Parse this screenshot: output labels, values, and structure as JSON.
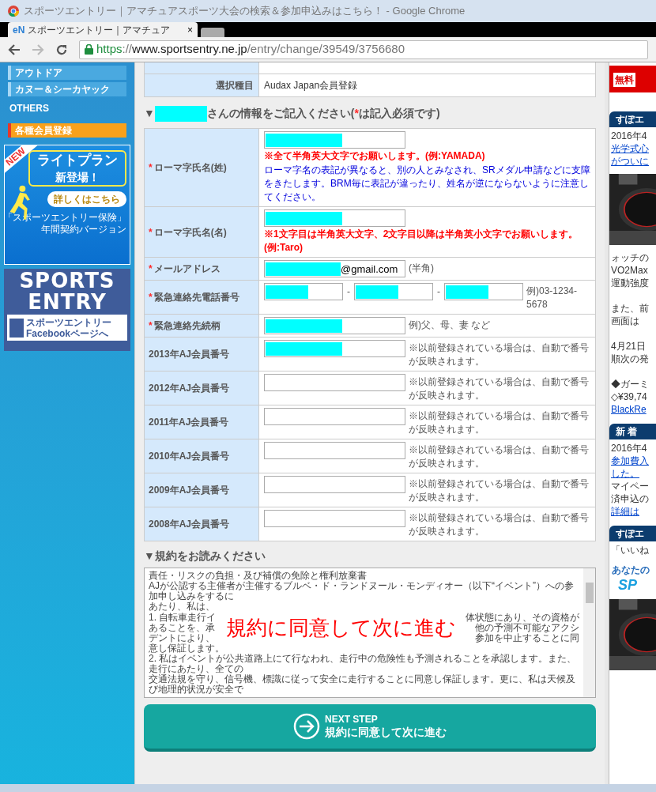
{
  "window": {
    "title": "スポーツエントリー｜アマチュアスポーツ大会の検索＆参加申込みはこちら！ - Google Chrome"
  },
  "tab": {
    "icon": "eN",
    "label": "スポーツエントリー｜アマチュア",
    "close": "×"
  },
  "address_bar": {
    "parts": [
      {
        "text": "https",
        "kind": "secure"
      },
      {
        "text": "://",
        "kind": "dim"
      },
      {
        "text": "www.sportsentry.ne.jp",
        "kind": "host"
      },
      {
        "text": "/entry/change/39549/3756680",
        "kind": "dim"
      }
    ]
  },
  "sidebar": {
    "items": [
      {
        "label": "アウトドア",
        "kind": "category"
      },
      {
        "label": "カヌー＆シーカヤック",
        "kind": "category"
      },
      {
        "label": "OTHERS",
        "kind": "heading"
      },
      {
        "label": "各種会員登録",
        "kind": "highlight"
      }
    ],
    "banner": {
      "badge": "NEW",
      "title": "ライトプラン",
      "subtitle": "新登場！",
      "button": "詳しくはこちら",
      "caption": [
        "「スポーツエントリー保険」",
        "年間契約バージョン"
      ]
    },
    "logo_banner": {
      "lines": [
        "SPORTS",
        "ENTRY"
      ],
      "facebook": [
        "スポーツエントリー",
        "Facebookページへ"
      ]
    }
  },
  "summary_rows": [
    {
      "label": "選択種目",
      "value": "Audax Japan会員登録"
    }
  ],
  "form_heading": {
    "marker": "▼",
    "before": "さんの情報をご記入ください(",
    "mark": "*",
    "after": "は記入必須です)"
  },
  "form_rows": [
    {
      "label": "ローマ字氏名(姓)",
      "required": true,
      "inputs": [
        {
          "redacted": true,
          "kind": "wide"
        }
      ],
      "notes": [
        {
          "text": "※全て半角英大文字でお願いします。(例:YAMADA)",
          "kind": "warning"
        },
        {
          "text": "ローマ字名の表記が異なると、別の人とみなされ、SRメダル申請などに支障をきたします。BRM毎に表記が違ったり、姓名が逆にならないように注意してください。",
          "kind": "info"
        }
      ]
    },
    {
      "label": "ローマ字氏名(名)",
      "required": true,
      "inputs": [
        {
          "redacted": true,
          "kind": "wide"
        }
      ],
      "notes": [
        {
          "text": "※1文字目は半角英大文字、2文字目以降は半角英小文字でお願いします。(例:Taro)",
          "kind": "warning"
        }
      ]
    },
    {
      "label": "メールアドレス",
      "required": true,
      "inputs": [
        {
          "redacted": true,
          "kind": "wide",
          "value": "@gmail.com"
        }
      ],
      "suffix": "(半角)"
    },
    {
      "label": "緊急連絡先電話番号",
      "required": true,
      "inputs": [
        {
          "redacted": true,
          "kind": "short",
          "after": "-"
        },
        {
          "redacted": true,
          "kind": "short",
          "after": "-"
        },
        {
          "redacted": true,
          "kind": "short"
        }
      ],
      "suffix": "例)03-1234-5678"
    },
    {
      "label": "緊急連絡先続柄",
      "required": true,
      "inputs": [
        {
          "redacted": true,
          "kind": "wide"
        }
      ],
      "suffix": "例)父、母、妻 など"
    },
    {
      "label": "2013年AJ会員番号",
      "required": false,
      "inputs": [
        {
          "redacted": true,
          "kind": "wide"
        }
      ],
      "suffix": "※以前登録されている場合は、自動で番号が反映されます。"
    },
    {
      "label": "2012年AJ会員番号",
      "required": false,
      "inputs": [
        {
          "redacted": false,
          "kind": "wide"
        }
      ],
      "suffix": "※以前登録されている場合は、自動で番号が反映されます。"
    },
    {
      "label": "2011年AJ会員番号",
      "required": false,
      "inputs": [
        {
          "redacted": false,
          "kind": "wide"
        }
      ],
      "suffix": "※以前登録されている場合は、自動で番号が反映されます。"
    },
    {
      "label": "2010年AJ会員番号",
      "required": false,
      "inputs": [
        {
          "redacted": false,
          "kind": "wide"
        }
      ],
      "suffix": "※以前登録されている場合は、自動で番号が反映されます。"
    },
    {
      "label": "2009年AJ会員番号",
      "required": false,
      "inputs": [
        {
          "redacted": false,
          "kind": "wide"
        }
      ],
      "suffix": "※以前登録されている場合は、自動で番号が反映されます。"
    },
    {
      "label": "2008年AJ会員番号",
      "required": false,
      "inputs": [
        {
          "redacted": false,
          "kind": "wide"
        }
      ],
      "suffix": "※以前登録されている場合は、自動で番号が反映されます。"
    }
  ],
  "terms": {
    "heading": "▼規約をお読みください",
    "before": [
      "責任・リスクの負担・及び補償の免除と権利放棄書",
      "AJが公認する主催者が主催するブルベ・ド・ランドヌール・モンディオー（以下“イベント”）への参加申し込みをするに",
      "あたり、私は、"
    ],
    "covered_rows": [
      {
        "left": "1. 自転車走行イ",
        "right": "体状態にあり、その資格が"
      },
      {
        "left": "あることを、承",
        "right": "他の予測不可能なアクシ"
      },
      {
        "left": "デントにより、",
        "right": "参加を中止することに同"
      }
    ],
    "after": [
      "意し保証します。",
      "2. 私はイベントが公共道路上にて行なわれ、走行中の危険性も予測されることを承認します。また、走行にあたり、全ての",
      "交通法規を守り、信号機、標識に従って安全に走行することに同意し保証します。更に、私は天候及び地理的状況が安全で"
    ]
  },
  "next_button": {
    "eyebrow": "NEXT STEP",
    "label": "規約に同意して次に進む"
  },
  "annotation": {
    "text": "規約に同意して次に進む"
  },
  "right_sidebar": [
    {
      "kind": "button",
      "text": "無料"
    },
    {
      "kind": "heading",
      "text": "すぽエ"
    },
    {
      "kind": "text",
      "text": "2016年4"
    },
    {
      "kind": "link",
      "text": "光学式心"
    },
    {
      "kind": "link",
      "text": "がついに"
    },
    {
      "kind": "picture"
    },
    {
      "kind": "text",
      "text": "ォッチの"
    },
    {
      "kind": "text",
      "text": "VO2Max"
    },
    {
      "kind": "text",
      "text": "運動強度"
    },
    {
      "kind": "para",
      "text": "また、前"
    },
    {
      "kind": "text",
      "text": "画面は"
    },
    {
      "kind": "para",
      "text": "4月21日"
    },
    {
      "kind": "text",
      "text": "順次の発"
    },
    {
      "kind": "para",
      "text": "◆ガーミ"
    },
    {
      "kind": "text",
      "text": "◇¥39,74"
    },
    {
      "kind": "link",
      "text": "BlackRe"
    },
    {
      "kind": "heading",
      "text": "新 着"
    },
    {
      "kind": "text",
      "text": "2016年4"
    },
    {
      "kind": "link",
      "text": "参加費入"
    },
    {
      "kind": "link",
      "text": "した。"
    },
    {
      "kind": "text",
      "text": "マイペー"
    },
    {
      "kind": "text",
      "text": "済申込の"
    },
    {
      "kind": "link",
      "text": "詳細は"
    },
    {
      "kind": "heading",
      "text": "すぽエ"
    },
    {
      "kind": "text",
      "text": "「いいね"
    },
    {
      "kind": "logo",
      "text": "あなたの",
      "mark": "SP"
    },
    {
      "kind": "picture"
    }
  ]
}
